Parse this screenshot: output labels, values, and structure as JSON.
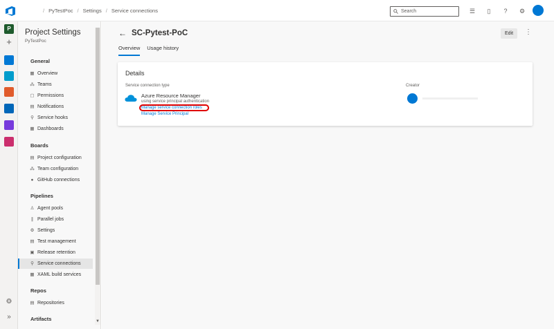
{
  "breadcrumb": [
    "/",
    "PyTestPoc",
    "/",
    "Settings",
    "/",
    "Service connections"
  ],
  "search": {
    "placeholder": "Search"
  },
  "rail": {
    "project_initial": "P",
    "colors": [
      "#0078d4",
      "#009ccc",
      "#cb2e6d",
      "#0066b8",
      "#773adc",
      "#cb2e6d"
    ]
  },
  "nav": {
    "title": "Project Settings",
    "subtitle": "PyTestPoc",
    "sections": {
      "general": "General",
      "boards": "Boards",
      "pipelines": "Pipelines",
      "repos": "Repos",
      "artifacts": "Artifacts"
    },
    "general_items": [
      "Overview",
      "Teams",
      "Permissions",
      "Notifications",
      "Service hooks",
      "Dashboards"
    ],
    "boards_items": [
      "Project configuration",
      "Team configuration",
      "GitHub connections"
    ],
    "pipelines_items": [
      "Agent pools",
      "Parallel jobs",
      "Settings",
      "Test management",
      "Release retention",
      "Service connections",
      "XAML build services"
    ],
    "repos_items": [
      "Repositories"
    ],
    "active_item": "Service connections"
  },
  "main": {
    "title": "SC-Pytest-PoC",
    "edit_label": "Edit",
    "tabs": [
      "Overview",
      "Usage history"
    ],
    "active_tab": "Overview",
    "card": {
      "heading": "Details",
      "type_label": "Service connection type",
      "type_name": "Azure Resource Manager",
      "type_desc": "using service principal authentication",
      "link_roles": "Manage service connection roles",
      "link_principal": "Manage Service Principal",
      "creator_label": "Creator"
    }
  },
  "colors": {
    "accent": "#0078d4",
    "highlight": "#e00000"
  }
}
